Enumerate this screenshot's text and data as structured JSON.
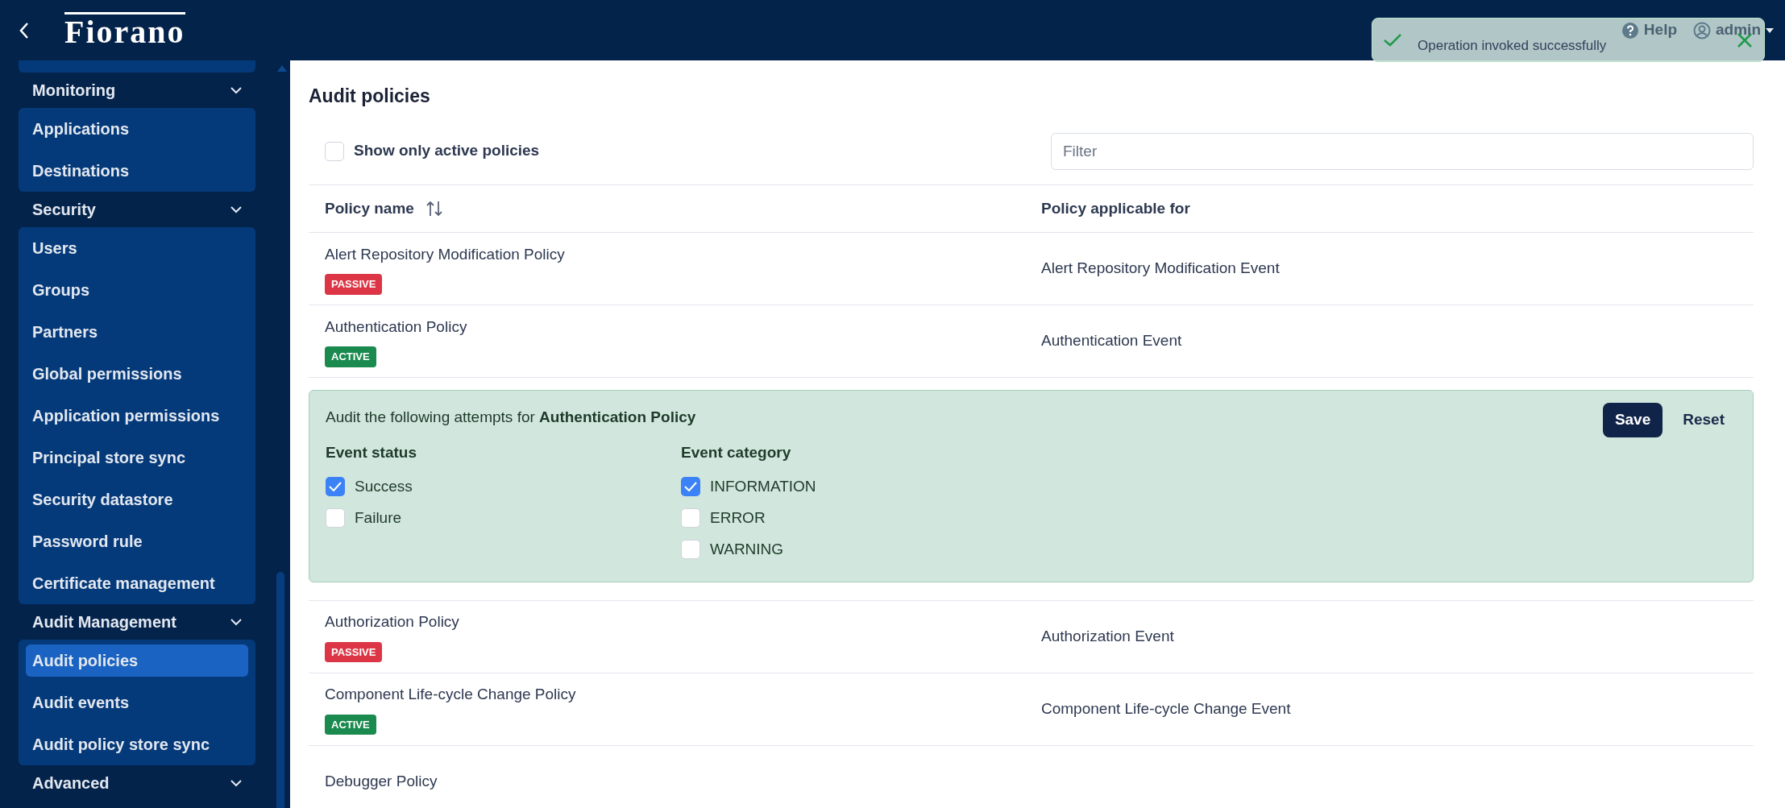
{
  "header": {
    "logo": "Fiorano",
    "help": "Help",
    "user": "admin"
  },
  "toast": {
    "message": "Operation invoked successfully"
  },
  "sidebar": {
    "groups": [
      {
        "label": "Monitoring",
        "items": [
          {
            "label": "Applications",
            "selected": false
          },
          {
            "label": "Destinations",
            "selected": false
          }
        ]
      },
      {
        "label": "Security",
        "items": [
          {
            "label": "Users",
            "selected": false
          },
          {
            "label": "Groups",
            "selected": false
          },
          {
            "label": "Partners",
            "selected": false
          },
          {
            "label": "Global permissions",
            "selected": false
          },
          {
            "label": "Application permissions",
            "selected": false
          },
          {
            "label": "Principal store sync",
            "selected": false
          },
          {
            "label": "Security datastore",
            "selected": false
          },
          {
            "label": "Password rule",
            "selected": false
          },
          {
            "label": "Certificate management",
            "selected": false
          }
        ]
      },
      {
        "label": "Audit Management",
        "items": [
          {
            "label": "Audit policies",
            "selected": true
          },
          {
            "label": "Audit events",
            "selected": false
          },
          {
            "label": "Audit policy store sync",
            "selected": false
          }
        ]
      },
      {
        "label": "Advanced"
      }
    ]
  },
  "page": {
    "title": "Audit policies"
  },
  "filter_bar": {
    "checkbox_label": "Show only active policies",
    "checked": false,
    "filter_placeholder": "Filter"
  },
  "table": {
    "columns": [
      "Policy name",
      "Policy applicable for"
    ],
    "rows": [
      {
        "name": "Alert Repository Modification Policy",
        "badge": "PASSIVE",
        "active": false,
        "event": "Alert Repository Modification Event"
      },
      {
        "name": "Authentication Policy",
        "badge": "ACTIVE",
        "active": true,
        "event": "Authentication Event",
        "details": {
          "intro": "Audit the following attempts for **Authentication Policy**",
          "groups": [
            {
              "title": "Event status",
              "options": [
                {
                  "label": "Success",
                  "checked": true
                },
                {
                  "label": "Failure",
                  "checked": false
                }
              ]
            },
            {
              "title": "Event category",
              "options": [
                {
                  "label": "INFORMATION",
                  "checked": true
                },
                {
                  "label": "ERROR",
                  "checked": false
                },
                {
                  "label": "WARNING",
                  "checked": false
                }
              ]
            }
          ],
          "buttons": [
            {
              "label": "Save",
              "kind": "primary"
            },
            {
              "label": "Reset",
              "kind": "plain"
            }
          ]
        }
      },
      {
        "name": "Authorization Policy",
        "badge": "PASSIVE",
        "active": false,
        "event": "Authorization Event"
      },
      {
        "name": "Component Life-cycle Change Policy",
        "badge": "ACTIVE",
        "active": true,
        "event": "Component Life-cycle Change Event"
      },
      {
        "name": "Debugger Policy"
      }
    ]
  }
}
